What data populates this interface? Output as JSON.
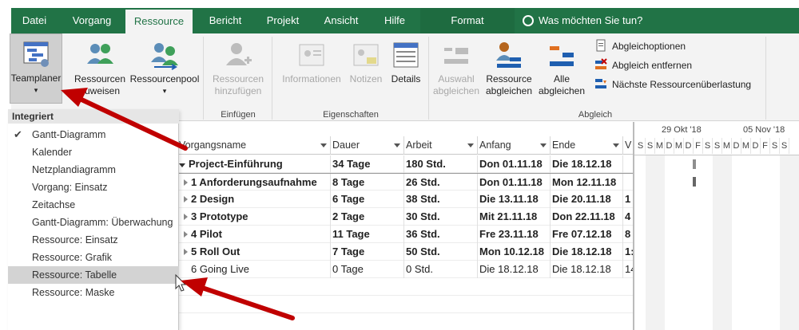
{
  "tabs": [
    {
      "label": "Datei"
    },
    {
      "label": "Vorgang"
    },
    {
      "label": "Ressource"
    },
    {
      "label": "Bericht"
    },
    {
      "label": "Projekt"
    },
    {
      "label": "Ansicht"
    },
    {
      "label": "Hilfe"
    },
    {
      "label": "Format"
    }
  ],
  "tell_me": "Was möchten Sie tun?",
  "ribbon": {
    "teamplaner": "Teamplaner",
    "ressourcen_zuweisen": [
      "Ressourcen",
      "zuweisen"
    ],
    "ressourcenpool": "Ressourcenpool",
    "ressourcen_hinzufuegen": [
      "Ressourcen",
      "hinzufügen"
    ],
    "einfuegen_group": "Einfügen",
    "informationen": "Informationen",
    "notizen": "Notizen",
    "details": "Details",
    "eigenschaften_group": "Eigenschaften",
    "auswahl_abgleichen": [
      "Auswahl",
      "abgleichen"
    ],
    "ressource_abgleichen": [
      "Ressource",
      "abgleichen"
    ],
    "alle_abgleichen": [
      "Alle",
      "abgleichen"
    ],
    "abgleichsoptionen": "Abgleichoptionen",
    "abgleich_entfernen": "Abgleich entfernen",
    "naechste_ueberlastung": "Nächste Ressourcenüberlastung",
    "abgleich_group": "Abgleich"
  },
  "menu": {
    "header": "Integriert",
    "items": [
      {
        "label": "Gantt-Diagramm",
        "checked": true
      },
      {
        "label": "Kalender"
      },
      {
        "label": "Netzplandiagramm"
      },
      {
        "label": "Vorgang: Einsatz"
      },
      {
        "label": "Zeitachse"
      },
      {
        "label": "Gantt-Diagramm: Überwachung"
      },
      {
        "label": "Ressource: Einsatz"
      },
      {
        "label": "Ressource: Grafik"
      },
      {
        "label": "Ressource: Tabelle",
        "selected": true
      },
      {
        "label": "Ressource: Maske"
      }
    ]
  },
  "table": {
    "columns": [
      "Vorgangsname",
      "Dauer",
      "Arbeit",
      "Anfang",
      "Ende",
      "V"
    ],
    "rows": [
      {
        "name": "Project-Einführung",
        "dauer": "34 Tage",
        "arbeit": "180 Std.",
        "anfang": "Don 01.11.18",
        "ende": "Die 18.12.18",
        "v": "",
        "bold": true,
        "summary": true
      },
      {
        "name": "1 Anforderungsaufnahme",
        "dauer": "8 Tage",
        "arbeit": "26 Std.",
        "anfang": "Don 01.11.18",
        "ende": "Mon 12.11.18",
        "v": "",
        "bold": true
      },
      {
        "name": "2 Design",
        "dauer": "6 Tage",
        "arbeit": "38 Std.",
        "anfang": "Die 13.11.18",
        "ende": "Die 20.11.18",
        "v": "1",
        "bold": true
      },
      {
        "name": "3 Prototype",
        "dauer": "2 Tage",
        "arbeit": "30 Std.",
        "anfang": "Mit 21.11.18",
        "ende": "Don 22.11.18",
        "v": "4",
        "bold": true
      },
      {
        "name": "4 Pilot",
        "dauer": "11 Tage",
        "arbeit": "36 Std.",
        "anfang": "Fre 23.11.18",
        "ende": "Fre 07.12.18",
        "v": "8",
        "bold": true
      },
      {
        "name": "5 Roll Out",
        "dauer": "7 Tage",
        "arbeit": "50 Std.",
        "anfang": "Mon 10.12.18",
        "ende": "Die 18.12.18",
        "v": "1:",
        "bold": true
      },
      {
        "name": "6 Going Live",
        "dauer": "0 Tage",
        "arbeit": "0 Std.",
        "anfang": "Die 18.12.18",
        "ende": "Die 18.12.18",
        "v": "14",
        "bold": false
      }
    ]
  },
  "timescale": {
    "weeks": [
      "29 Okt '18",
      "05 Nov '18"
    ],
    "days": [
      "S",
      "S",
      "M",
      "D",
      "M",
      "D",
      "F",
      "S",
      "S",
      "M",
      "D",
      "M",
      "D",
      "F",
      "S",
      "S"
    ]
  },
  "colors": {
    "ribbon_green": "#217346",
    "ribbon_bg": "#f3f3f3",
    "arrow_red": "#c00000",
    "selected_item": "#d3d3d3"
  }
}
